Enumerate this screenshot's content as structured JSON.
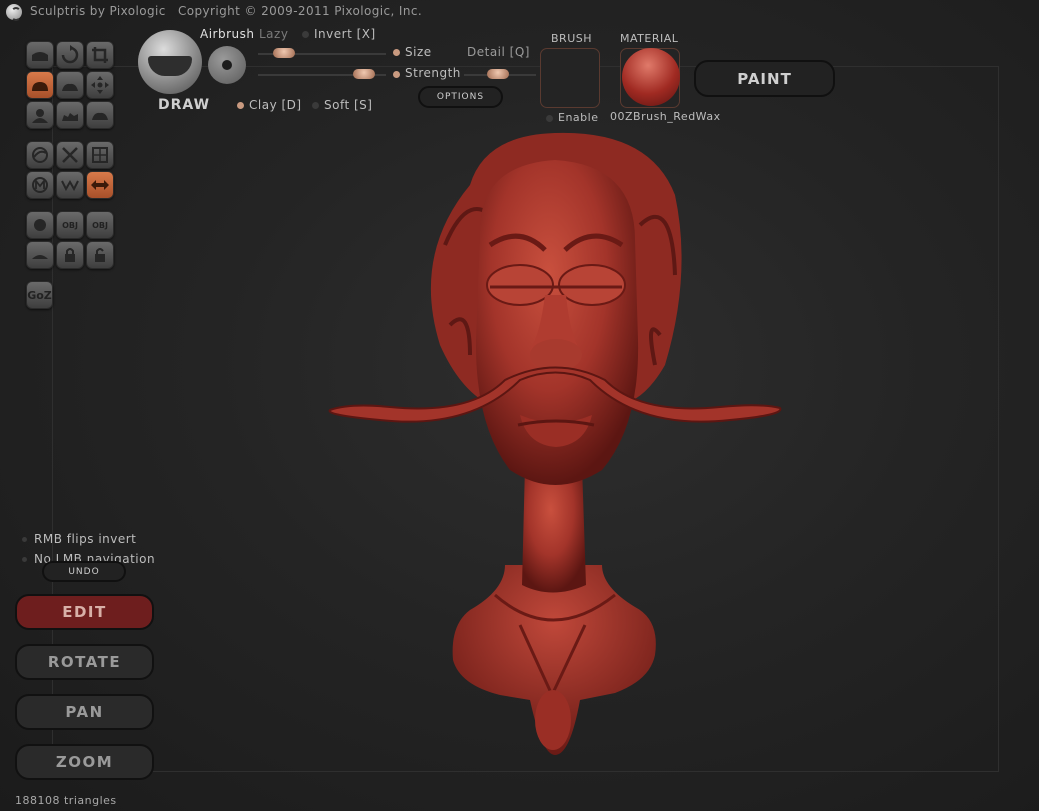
{
  "window": {
    "app_title": "Sculptris by Pixologic",
    "copyright": "Copyright © 2009-2011 Pixologic, Inc."
  },
  "toolbar": {
    "brush_name": "DRAW",
    "airbrush_label": "Airbrush",
    "lazy_label": "Lazy",
    "invert_label": "Invert [X]",
    "size_label": "Size",
    "strength_label": "Strength",
    "detail_label": "Detail [Q]",
    "clay_label": "Clay [D]",
    "soft_label": "Soft [S]",
    "options_label": "OPTIONS",
    "brush_header": "BRUSH",
    "brush_enable_label": "Enable",
    "material_header": "MATERIAL",
    "material_name": "00ZBrush_RedWax",
    "paint_label": "PAINT",
    "size_value": 0.2,
    "strength_value": 0.9,
    "detail_value": 0.5,
    "invert_enabled": false,
    "clay_enabled": true,
    "soft_enabled": false,
    "brush_enable": false
  },
  "tools": {
    "groups": [
      [
        "draw",
        "rotate",
        "crop",
        "inflate",
        "flatten",
        "pinch",
        "grab",
        "smooth",
        "crease"
      ],
      [
        "symmetry",
        "no-symmetry",
        "wireframe",
        "mask",
        "pinch-brush",
        "move-arrows"
      ],
      [
        "sphere",
        "obj-import",
        "obj-export",
        "plane",
        "lock",
        "unlock"
      ]
    ],
    "goz_label": "GoZ",
    "obj_label": "OBJ"
  },
  "left_panel": {
    "rmb_label": "RMB flips invert",
    "lmb_label": "No LMB navigation",
    "undo_label": "UNDO",
    "edit_label": "EDIT",
    "rotate_label": "ROTATE",
    "pan_label": "PAN",
    "zoom_label": "ZOOM"
  },
  "status": {
    "triangles": "188108 triangles"
  },
  "colors": {
    "accent_orange": "#c8683a",
    "edit_active": "#6e1e1e",
    "model_red": "#a8342a"
  }
}
